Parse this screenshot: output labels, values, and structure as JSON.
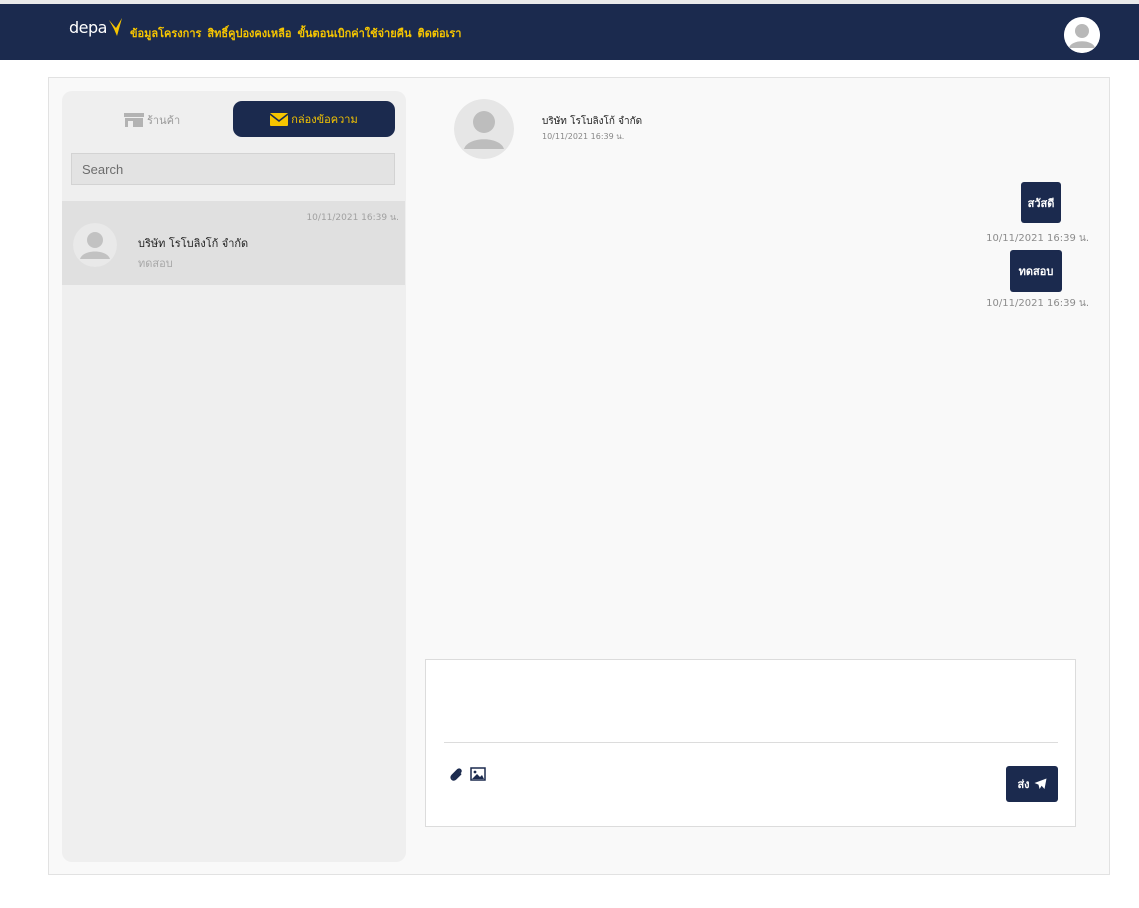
{
  "navbar": {
    "logo_text": "depa",
    "links": [
      "ข้อมูลโครงการ",
      "สิทธิ์คูปองคงเหลือ",
      "ขั้นตอนเบิกค่าใช้จ่ายคืน",
      "ติดต่อเรา"
    ]
  },
  "sidebar": {
    "tab_store_label": "ร้านค้า",
    "tab_inbox_label": "กล่องข้อความ",
    "search_placeholder": "Search",
    "conversations": [
      {
        "name": "บริษัท โรโบลิงโก้ จำกัด",
        "preview": "ทดสอบ",
        "time": "10/11/2021 16:39 น."
      }
    ]
  },
  "chat": {
    "header": {
      "name": "บริษัท โรโบลิงโก้ จำกัด",
      "time": "10/11/2021 16:39 น."
    },
    "messages": [
      {
        "text": "สวัสดี",
        "time": "10/11/2021 16:39 น."
      },
      {
        "text": "ทดสอบ",
        "time": "10/11/2021 16:39 น."
      }
    ]
  },
  "composer": {
    "send_label": "ส่ง"
  },
  "colors": {
    "navy": "#1b2a4e",
    "accent_yellow": "#f6c500"
  },
  "icons": [
    "depa-logo-mark",
    "user-avatar-icon",
    "store-icon",
    "envelope-icon",
    "paperclip-icon",
    "image-icon",
    "paper-plane-icon"
  ]
}
